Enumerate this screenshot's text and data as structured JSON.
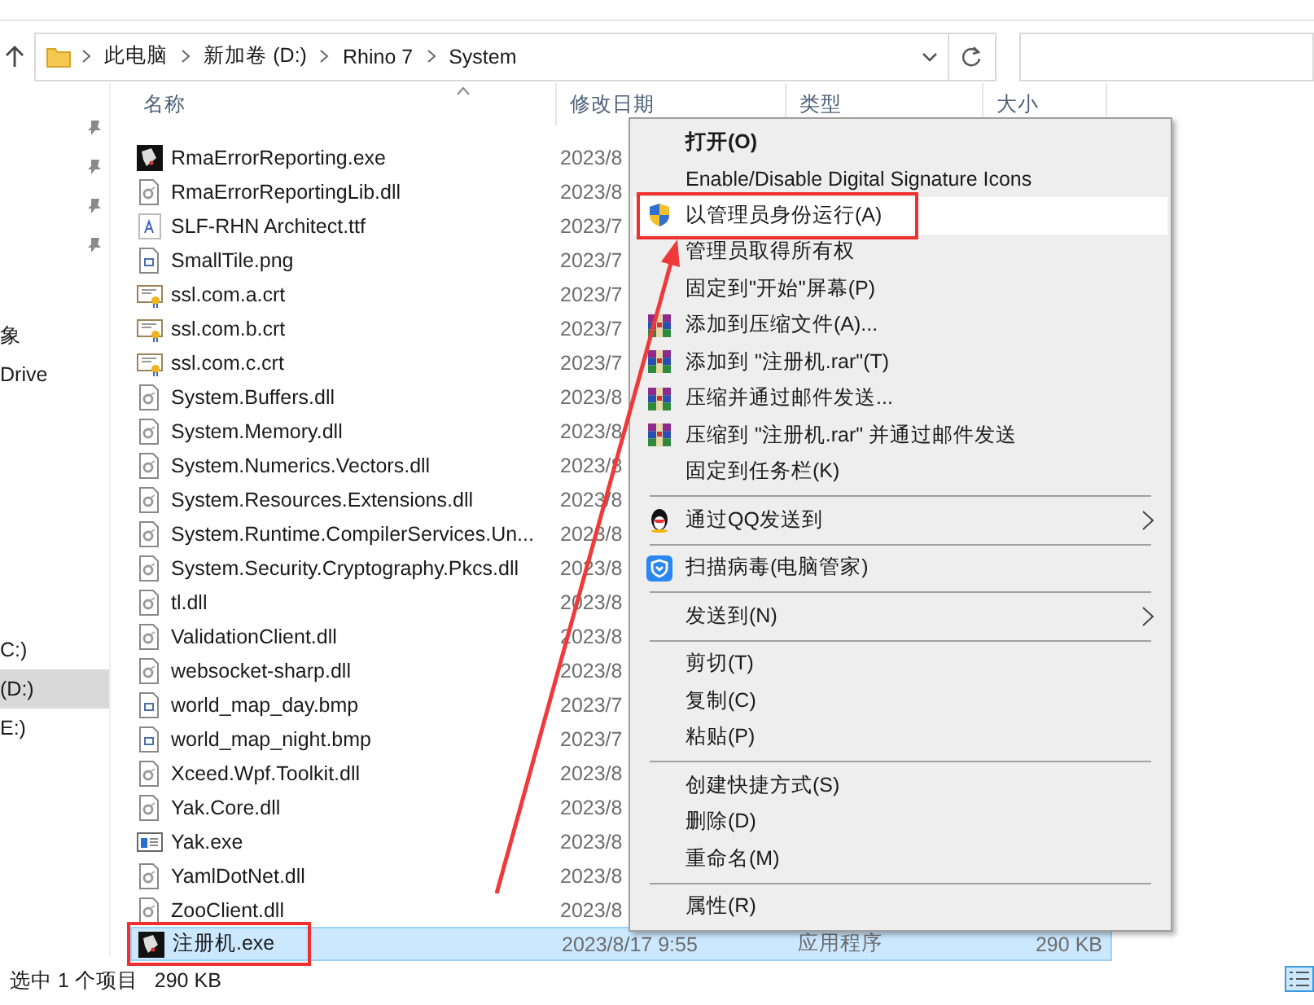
{
  "address_bar": {
    "path": [
      "此电脑",
      "新加卷 (D:)",
      "Rhino 7",
      "System"
    ]
  },
  "nav": [
    {
      "kind": "pin"
    },
    {
      "kind": "pin"
    },
    {
      "kind": "pin"
    },
    {
      "kind": "pin"
    },
    {
      "label": "象",
      "kind": "text",
      "selected": false
    },
    {
      "label": "Drive",
      "kind": "text",
      "selected": false
    },
    {
      "label": "C:)",
      "kind": "drive",
      "selected": false
    },
    {
      "label": "(D:)",
      "kind": "drive",
      "selected": true
    },
    {
      "label": "E:)",
      "kind": "drive",
      "selected": false
    }
  ],
  "columns": [
    "名称",
    "修改日期",
    "类型",
    "大小"
  ],
  "rows": [
    {
      "name": "RmaErrorReporting.exe",
      "kind": "exe",
      "date": "2023/8",
      "selected": false
    },
    {
      "name": "RmaErrorReportingLib.dll",
      "kind": "dll",
      "date": "2023/8",
      "selected": false
    },
    {
      "name": "SLF-RHN Architect.ttf",
      "kind": "font",
      "date": "2023/7",
      "selected": false
    },
    {
      "name": "SmallTile.png",
      "kind": "image",
      "date": "2023/7",
      "selected": false
    },
    {
      "name": "ssl.com.a.crt",
      "kind": "cert",
      "date": "2023/7",
      "selected": false
    },
    {
      "name": "ssl.com.b.crt",
      "kind": "cert",
      "date": "2023/7",
      "selected": false
    },
    {
      "name": "ssl.com.c.crt",
      "kind": "cert",
      "date": "2023/7",
      "selected": false
    },
    {
      "name": "System.Buffers.dll",
      "kind": "dll",
      "date": "2023/8",
      "selected": false
    },
    {
      "name": "System.Memory.dll",
      "kind": "dll",
      "date": "2023/8",
      "selected": false
    },
    {
      "name": "System.Numerics.Vectors.dll",
      "kind": "dll",
      "date": "2023/8",
      "selected": false
    },
    {
      "name": "System.Resources.Extensions.dll",
      "kind": "dll",
      "date": "2023/8",
      "selected": false
    },
    {
      "name": "System.Runtime.CompilerServices.Un...",
      "kind": "dll",
      "date": "2023/8",
      "selected": false
    },
    {
      "name": "System.Security.Cryptography.Pkcs.dll",
      "kind": "dll",
      "date": "2023/8",
      "selected": false
    },
    {
      "name": "tl.dll",
      "kind": "dll",
      "date": "2023/8",
      "selected": false
    },
    {
      "name": "ValidationClient.dll",
      "kind": "dll",
      "date": "2023/8",
      "selected": false
    },
    {
      "name": "websocket-sharp.dll",
      "kind": "dll",
      "date": "2023/8",
      "selected": false
    },
    {
      "name": "world_map_day.bmp",
      "kind": "image",
      "date": "2023/7",
      "selected": false
    },
    {
      "name": "world_map_night.bmp",
      "kind": "image",
      "date": "2023/7",
      "selected": false
    },
    {
      "name": "Xceed.Wpf.Toolkit.dll",
      "kind": "dll",
      "date": "2023/8",
      "selected": false
    },
    {
      "name": "Yak.Core.dll",
      "kind": "dll",
      "date": "2023/8",
      "selected": false
    },
    {
      "name": "Yak.exe",
      "kind": "app",
      "date": "2023/8",
      "selected": false
    },
    {
      "name": "YamlDotNet.dll",
      "kind": "dll",
      "date": "2023/8",
      "selected": false
    },
    {
      "name": "ZooClient.dll",
      "kind": "dll",
      "date": "2023/8",
      "selected": false
    },
    {
      "name": "注册机.exe",
      "kind": "exe",
      "date": "2023/8/17 9:55",
      "type": "应用程序",
      "size": "290 KB",
      "selected": true,
      "annotated": true
    }
  ],
  "context_menu": [
    {
      "kind": "plain",
      "label": "打开(O)",
      "bold": true,
      "selected": false
    },
    {
      "kind": "plain",
      "label": "Enable/Disable Digital Signature Icons",
      "selected": false
    },
    {
      "kind": "shield",
      "label": "以管理员身份运行(A)",
      "selected": true,
      "annotated": true
    },
    {
      "kind": "plain",
      "label": "管理员取得所有权",
      "selected": false
    },
    {
      "kind": "plain",
      "label": "固定到\"开始\"屏幕(P)",
      "selected": false
    },
    {
      "kind": "archive",
      "label": "添加到压缩文件(A)...",
      "selected": false
    },
    {
      "kind": "archive",
      "label": "添加到 \"注册机.rar\"(T)",
      "selected": false
    },
    {
      "kind": "archive",
      "label": "压缩并通过邮件发送...",
      "selected": false
    },
    {
      "kind": "archive",
      "label": "压缩到 \"注册机.rar\" 并通过邮件发送",
      "selected": false
    },
    {
      "kind": "plain",
      "label": "固定到任务栏(K)",
      "selected": false
    },
    {
      "kind": "separator"
    },
    {
      "kind": "qq",
      "label": "通过QQ发送到",
      "submenu": true,
      "selected": false
    },
    {
      "kind": "separator"
    },
    {
      "kind": "scan",
      "label": "扫描病毒(电脑管家)",
      "selected": false
    },
    {
      "kind": "separator"
    },
    {
      "kind": "plain",
      "label": "发送到(N)",
      "submenu": true,
      "selected": false
    },
    {
      "kind": "separator"
    },
    {
      "kind": "plain",
      "label": "剪切(T)",
      "selected": false
    },
    {
      "kind": "plain",
      "label": "复制(C)",
      "selected": false
    },
    {
      "kind": "plain",
      "label": "粘贴(P)",
      "selected": false
    },
    {
      "kind": "separator"
    },
    {
      "kind": "plain",
      "label": "创建快捷方式(S)",
      "selected": false
    },
    {
      "kind": "plain",
      "label": "删除(D)",
      "selected": false
    },
    {
      "kind": "plain",
      "label": "重命名(M)",
      "selected": false
    },
    {
      "kind": "separator"
    },
    {
      "kind": "plain",
      "label": "属性(R)",
      "selected": false
    }
  ],
  "status_bar": {
    "selection": "选中 1 个项目",
    "size": "290 KB"
  }
}
